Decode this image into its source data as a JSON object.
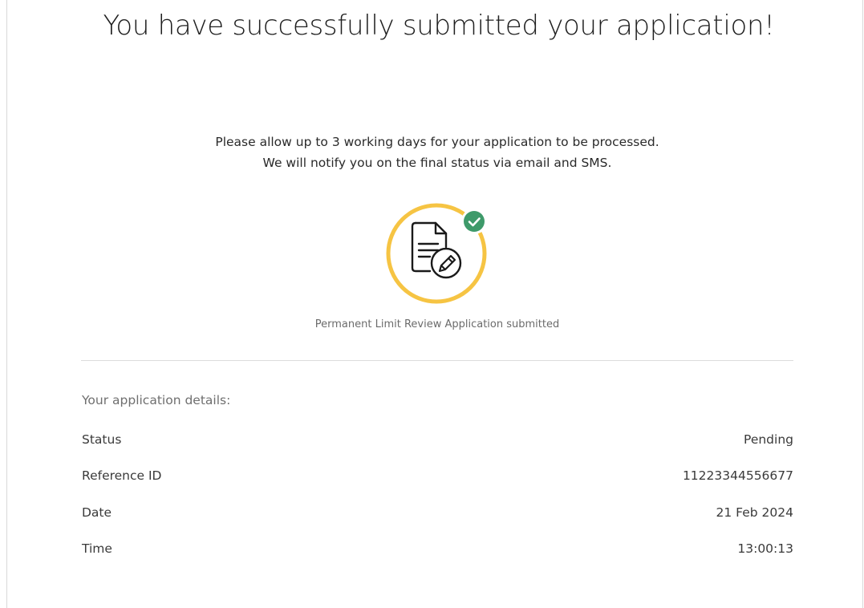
{
  "header": {
    "title": "You have successfully submitted your application!"
  },
  "notice": {
    "line1": "Please allow up to 3 working days for your application to be processed.",
    "line2": "We will notify you on the final status via email and SMS."
  },
  "illustration": {
    "icon": "document-edit-icon",
    "badge_icon": "check-badge-icon",
    "ring_color": "#F6C443",
    "badge_color": "#3E9A6A",
    "caption": "Permanent Limit Review Application submitted"
  },
  "details": {
    "heading": "Your application details:",
    "rows": [
      {
        "label": "Status",
        "value": "Pending"
      },
      {
        "label": "Reference ID",
        "value": "11223344556677"
      },
      {
        "label": "Date",
        "value": "21 Feb 2024"
      },
      {
        "label": "Time",
        "value": "13:00:13"
      }
    ]
  }
}
